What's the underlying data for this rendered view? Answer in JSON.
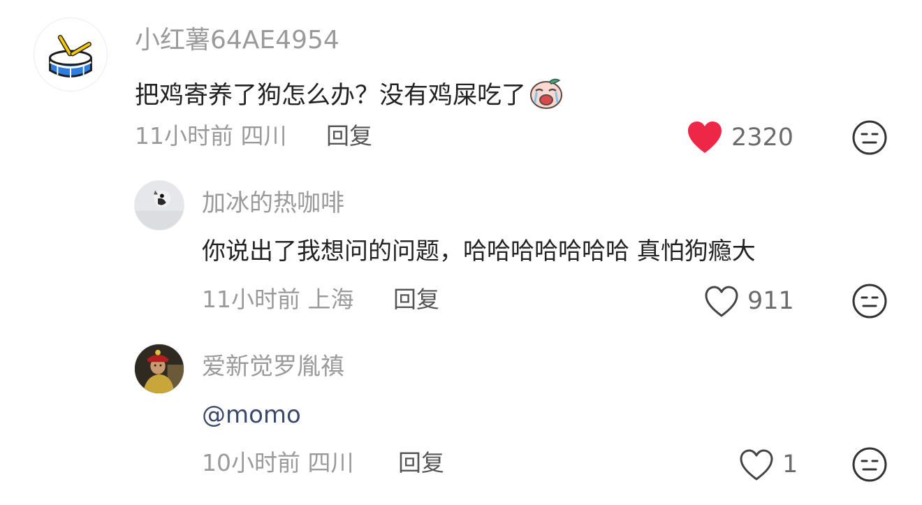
{
  "comments": [
    {
      "username": "小红薯64AE4954",
      "content": "把鸡寄养了狗怎么办？没有鸡屎吃了",
      "emoji_icon": "crying-face-sticker-icon",
      "time": "11小时前",
      "location": "四川",
      "time_location": "11小时前 四川",
      "reply_label": "回复",
      "likes": "2320",
      "liked": true,
      "avatar_icon": "drum-icon"
    },
    {
      "username": "加冰的热咖啡",
      "content": "你说出了我想问的问题，哈哈哈哈哈哈哈 真怕狗瘾大",
      "time": "11小时前",
      "location": "上海",
      "time_location": "11小时前 上海",
      "reply_label": "回复",
      "likes": "911",
      "liked": false,
      "avatar_icon": "cat-photo-avatar"
    },
    {
      "username": "爱新觉罗胤禛",
      "content": "@momo",
      "time": "10小时前",
      "location": "四川",
      "time_location": "10小时前 四川",
      "reply_label": "回复",
      "likes": "1",
      "liked": false,
      "avatar_icon": "emperor-photo-avatar"
    }
  ],
  "colors": {
    "like_active": "#ee2747",
    "text_primary": "#222222",
    "text_secondary": "#9a9a9a",
    "mention": "#3a4a6b"
  }
}
